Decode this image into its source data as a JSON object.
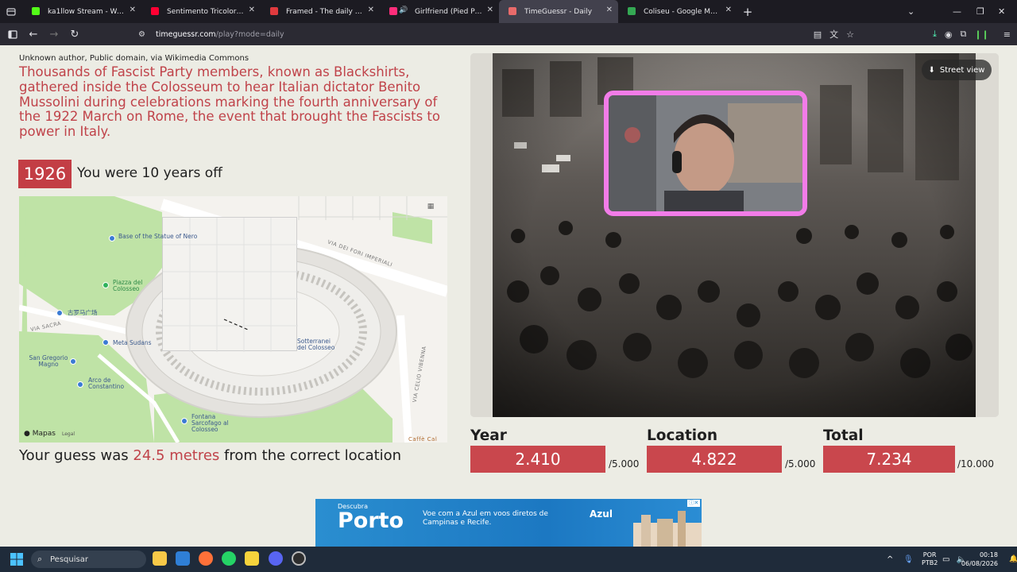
{
  "browser": {
    "tabs": [
      {
        "title": "ka1llow Stream - Watch Live on",
        "favicon_color": "#53fc18",
        "active": false
      },
      {
        "title": "Sentimento Tricolor - YouTube",
        "favicon_color": "#ff0033",
        "active": false
      },
      {
        "title": "Framed - The daily movie guess",
        "favicon_color": "#e03a3e",
        "active": false
      },
      {
        "title": "Girlfriend (Pied Piper Remix",
        "favicon_color": "#ff2d7a",
        "active": false,
        "audio": true
      },
      {
        "title": "TimeGuessr - Daily",
        "favicon_color": "#e86a6a",
        "active": true
      },
      {
        "title": "Coliseu - Google Maps",
        "favicon_color": "#34a853",
        "active": false
      }
    ],
    "url_domain": "timeguessr.com",
    "url_path": "/play?mode=daily"
  },
  "result": {
    "credit": "Unknown author, Public domain, via Wikimedia Commons",
    "description": "Thousands of Fascist Party members, known as Blackshirts, gathered inside the Colosseum to hear Italian dictator Benito Mussolini during celebrations marking the fourth anniversary of the 1922 March on Rome, the event that brought the Fascists to power in Italy.",
    "year": "1926",
    "year_feedback": "You were 10 years off",
    "guess_prefix": "Your guess was ",
    "guess_distance": "24.5 metres",
    "guess_suffix": " from the correct location"
  },
  "map": {
    "pois": [
      {
        "name": "Base of the Statue of Nero",
        "color": "#3b7bd4"
      },
      {
        "name": "Piazza del Colosseo",
        "color": "#2fb25b"
      },
      {
        "name": "古罗马广场",
        "color": "#3b7bd4"
      },
      {
        "name": "Meta Sudans",
        "color": "#3b7bd4"
      },
      {
        "name": "San Gregorio Magno",
        "color": "#3b7bd4"
      },
      {
        "name": "Arco de Constantino",
        "color": "#3b7bd4"
      },
      {
        "name": "Fontana Sarcofago al Colosseo",
        "color": "#3b7bd4"
      },
      {
        "name": "Sotterranei del Colosseo",
        "color": "#3b7bd4"
      }
    ],
    "streets": [
      "VIA DEI FORI IMPERIALI",
      "VIA SACRA",
      "VIA CELIO VIBENNA"
    ],
    "corner_label": "Caffè Cal",
    "attribution": "Mapas",
    "legal": "Legal"
  },
  "photo": {
    "street_view_label": "Street view"
  },
  "scores": [
    {
      "label": "Year",
      "value": "2.410",
      "max": "/5.000"
    },
    {
      "label": "Location",
      "value": "4.822",
      "max": "/5.000"
    },
    {
      "label": "Total",
      "value": "7.234",
      "max": "/10.000"
    }
  ],
  "ad": {
    "kicker": "Descubra",
    "headline": "Porto",
    "tagline": "Voe com a Azul em voos diretos de Campinas e Recife.",
    "brand": "Azul"
  },
  "taskbar": {
    "search_placeholder": "Pesquisar",
    "language": "POR",
    "keyboard": "PTB2",
    "time": "00:18",
    "date": "06/08/2026"
  },
  "colors": {
    "accent_red": "#c33e45",
    "page_bg": "#ecece4",
    "webcam_border": "#f27ce8"
  }
}
